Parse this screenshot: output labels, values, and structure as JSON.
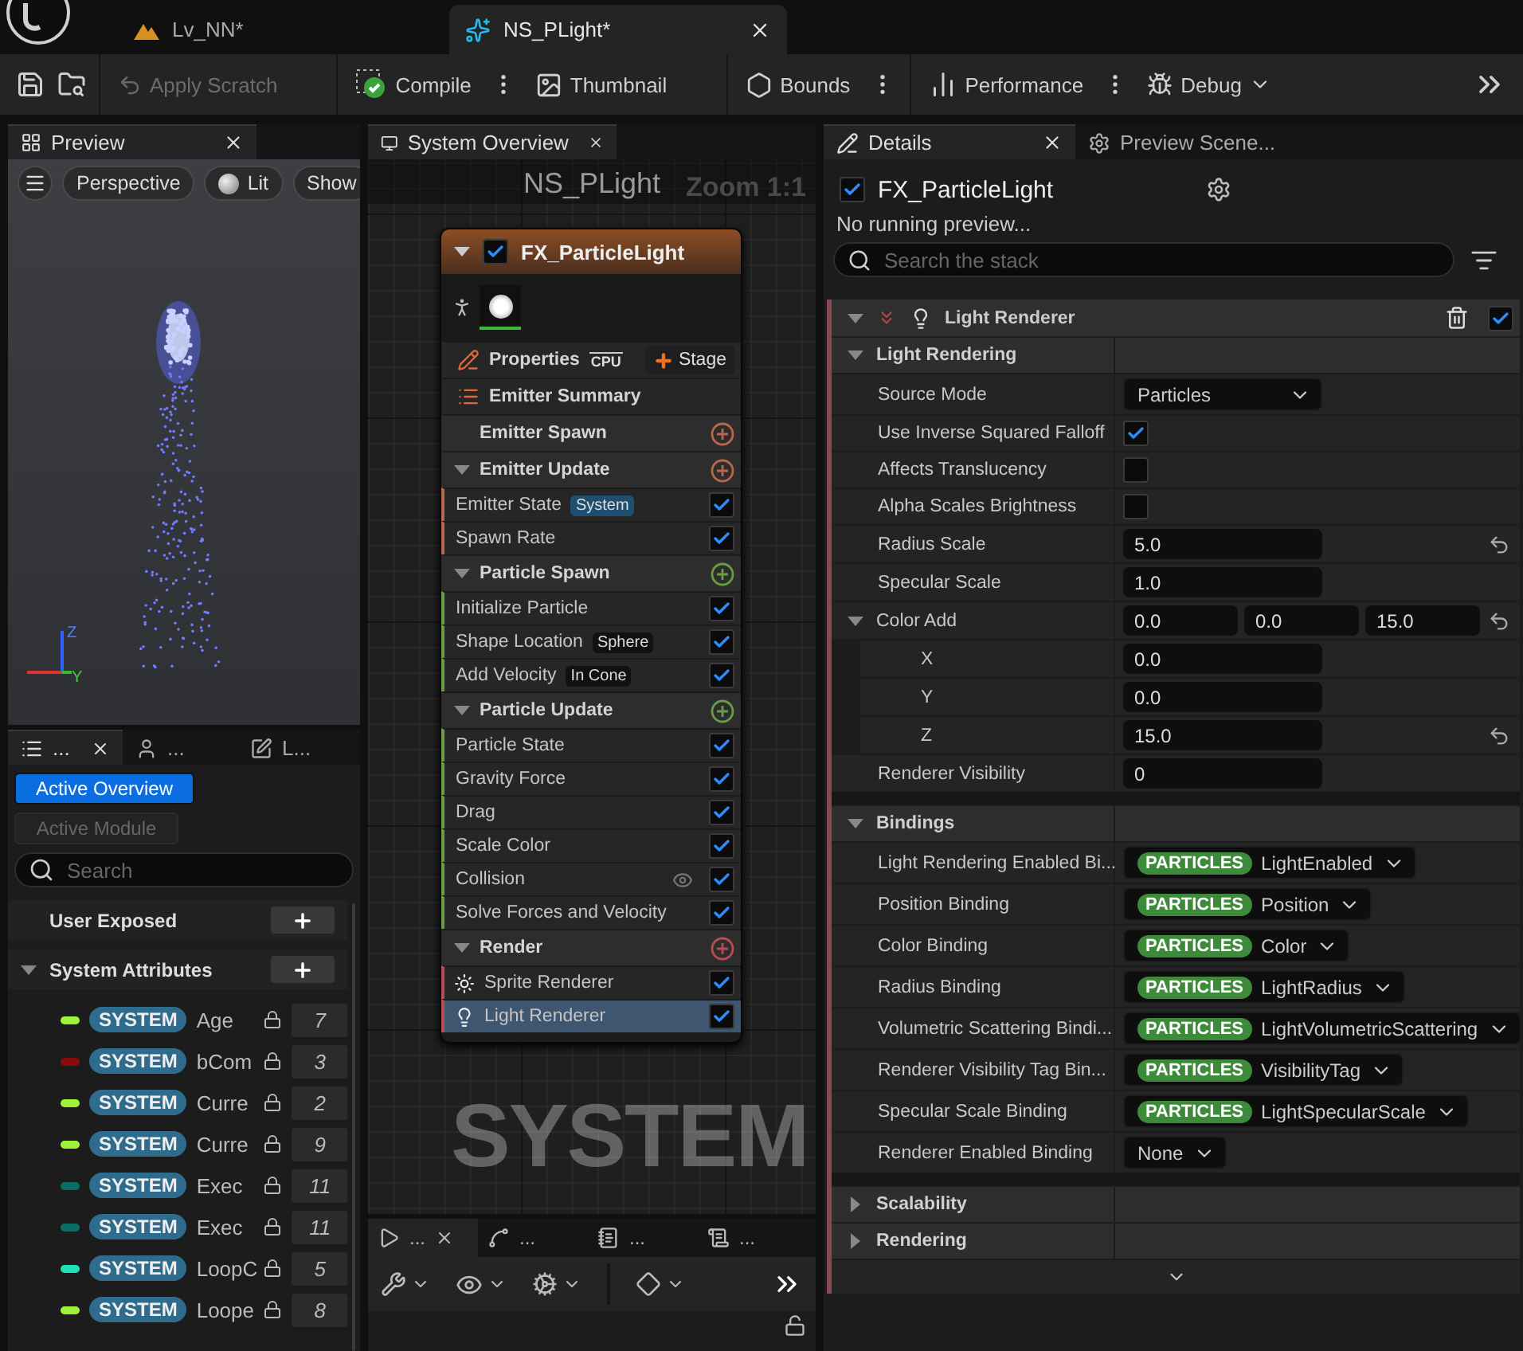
{
  "editor_tabs": [
    {
      "label": "Lv_NN*",
      "kind": "level",
      "selected": false
    },
    {
      "label": "NS_PLight*",
      "kind": "system",
      "selected": true
    }
  ],
  "toolbar": [
    {
      "label": "Apply Scratch",
      "kind": "scratch",
      "disabled": true,
      "options": false,
      "dropdown": false
    },
    {
      "label": "Compile",
      "kind": "compile",
      "disabled": false,
      "options": true,
      "dropdown": false
    },
    {
      "label": "Thumbnail",
      "kind": "thumbnail",
      "disabled": false,
      "options": false,
      "dropdown": false
    },
    {
      "label": "Bounds",
      "kind": "bounds",
      "disabled": false,
      "options": true,
      "dropdown": false
    },
    {
      "label": "Performance",
      "kind": "performance",
      "disabled": false,
      "options": true,
      "dropdown": false
    },
    {
      "label": "Debug",
      "kind": "debug",
      "disabled": false,
      "options": false,
      "dropdown": true
    }
  ],
  "preview": {
    "tab": "Preview",
    "view_buttons": [
      {
        "label": "Perspective",
        "kind": "view"
      },
      {
        "label": "Lit",
        "kind": "lighting"
      },
      {
        "label": "Show",
        "kind": "show"
      }
    ],
    "gizmo": [
      "Z",
      "Y"
    ]
  },
  "parameters": {
    "tabs": [
      {
        "label": "...",
        "selected": true
      },
      {
        "label": "...",
        "selected": false
      },
      {
        "label": "L...",
        "selected": false
      }
    ],
    "modes": [
      {
        "label": "Active Overview",
        "selected": true
      },
      {
        "label": "Active Module",
        "selected": false
      }
    ],
    "search": {
      "placeholder": "Search"
    },
    "sections": [
      {
        "title": "User Exposed"
      },
      {
        "title": "System Attributes",
        "expanded": true,
        "items": [
          {
            "namespace": "SYSTEM",
            "name": "Age",
            "color": "#9ef23a",
            "count": "7"
          },
          {
            "namespace": "SYSTEM",
            "name": "bCom",
            "color": "#8c0a0a",
            "count": "3"
          },
          {
            "namespace": "SYSTEM",
            "name": "Curre",
            "color": "#9ef23a",
            "count": "2"
          },
          {
            "namespace": "SYSTEM",
            "name": "Curre",
            "color": "#9ef23a",
            "count": "9"
          },
          {
            "namespace": "SYSTEM",
            "name": "Exec",
            "color": "#0b6e66",
            "count": "11"
          },
          {
            "namespace": "SYSTEM",
            "name": "Exec",
            "color": "#0b6e66",
            "count": "11"
          },
          {
            "namespace": "SYSTEM",
            "name": "LoopC",
            "color": "#1ee0b4",
            "count": "5"
          },
          {
            "namespace": "SYSTEM",
            "name": "Loope",
            "color": "#9ef23a",
            "count": "8"
          }
        ]
      }
    ]
  },
  "overview": {
    "tab": "System Overview",
    "graph_title": "NS_PLight",
    "zoom": "Zoom 1:1",
    "watermark": "SYSTEM",
    "node": {
      "name": "FX_ParticleLight",
      "enabled": true,
      "properties": "Properties",
      "sim_target": "CPU",
      "add_stage": "Stage",
      "summary": "Emitter Summary",
      "groups": [
        {
          "title": "Emitter Spawn",
          "color": "#b8664c"
        },
        {
          "title": "Emitter Update",
          "color": "#b8664c",
          "expanded": true,
          "modules": [
            {
              "label": "Emitter State",
              "kind": "module",
              "tag": {
                "text": "System",
                "kind": "namespace"
              },
              "enabled": true,
              "selected": false
            },
            {
              "label": "Spawn Rate",
              "kind": "module",
              "enabled": true,
              "selected": false
            }
          ]
        },
        {
          "title": "Particle Spawn",
          "color": "#6a9c46",
          "expanded": true,
          "modules": [
            {
              "label": "Initialize Particle",
              "kind": "module",
              "enabled": true,
              "selected": false
            },
            {
              "label": "Shape Location",
              "kind": "module",
              "tag": {
                "text": "Sphere",
                "kind": "mode"
              },
              "enabled": true,
              "selected": false
            },
            {
              "label": "Add Velocity",
              "kind": "module",
              "tag": {
                "text": "In Cone",
                "kind": "mode"
              },
              "enabled": true,
              "selected": false
            }
          ]
        },
        {
          "title": "Particle Update",
          "color": "#6a9c46",
          "expanded": true,
          "modules": [
            {
              "label": "Particle State",
              "kind": "module",
              "enabled": true,
              "selected": false
            },
            {
              "label": "Gravity Force",
              "kind": "module",
              "enabled": true,
              "selected": false
            },
            {
              "label": "Drag",
              "kind": "module",
              "enabled": true,
              "selected": false
            },
            {
              "label": "Scale Color",
              "kind": "module",
              "enabled": true,
              "selected": false
            },
            {
              "label": "Collision",
              "kind": "module",
              "debug": true,
              "enabled": true,
              "selected": false
            },
            {
              "label": "Solve Forces and Velocity",
              "kind": "module",
              "enabled": true,
              "selected": false
            }
          ]
        },
        {
          "title": "Render",
          "color": "#b84c54",
          "expanded": true,
          "modules": [
            {
              "label": "Sprite Renderer",
              "kind": "sprite",
              "enabled": true,
              "selected": false
            },
            {
              "label": "Light Renderer",
              "kind": "light",
              "enabled": true,
              "selected": true
            }
          ]
        }
      ]
    }
  },
  "bottom_panel": {
    "tabs": [
      {
        "label": "...",
        "selected": true
      },
      {
        "label": "...",
        "selected": false
      },
      {
        "label": "...",
        "selected": false
      },
      {
        "label": "...",
        "selected": false
      }
    ]
  },
  "details": {
    "tabs": [
      {
        "label": "Details",
        "selected": true
      },
      {
        "label": "Preview Scene...",
        "selected": false
      }
    ],
    "emitter": {
      "name": "FX_ParticleLight",
      "enabled": true
    },
    "status": "No running preview...",
    "search": {
      "placeholder": "Search the stack"
    },
    "renderer": {
      "name": "Light Renderer",
      "enabled": true
    },
    "sections": [
      {
        "title": "Light Rendering",
        "expanded": true,
        "rows": [
          {
            "label": "Source Mode",
            "kind": "dropdown",
            "value": "Particles"
          },
          {
            "label": "Use Inverse Squared Falloff",
            "kind": "checkbox",
            "checked": true
          },
          {
            "label": "Affects Translucency",
            "kind": "checkbox",
            "checked": false
          },
          {
            "label": "Alpha Scales Brightness",
            "kind": "checkbox",
            "checked": false
          },
          {
            "label": "Radius Scale",
            "kind": "number",
            "value": "5.0",
            "modified": true
          },
          {
            "label": "Specular Scale",
            "kind": "number",
            "value": "1.0",
            "modified": false
          },
          {
            "label": "Color Add",
            "kind": "vector",
            "values": [
              "0.0",
              "0.0",
              "15.0"
            ],
            "modified": true,
            "expanded": true,
            "children": [
              {
                "label": "X",
                "kind": "number",
                "value": "0.0",
                "modified": false
              },
              {
                "label": "Y",
                "kind": "number",
                "value": "0.0",
                "modified": false
              },
              {
                "label": "Z",
                "kind": "number",
                "value": "15.0",
                "modified": true
              }
            ]
          },
          {
            "label": "Renderer Visibility",
            "kind": "number",
            "value": "0",
            "modified": false
          }
        ]
      },
      {
        "title": "Bindings",
        "expanded": true,
        "rows": [
          {
            "label": "Light Rendering Enabled Bi...",
            "kind": "binding",
            "namespace": "PARTICLES",
            "value": "LightEnabled"
          },
          {
            "label": "Position Binding",
            "kind": "binding",
            "namespace": "PARTICLES",
            "value": "Position"
          },
          {
            "label": "Color Binding",
            "kind": "binding",
            "namespace": "PARTICLES",
            "value": "Color"
          },
          {
            "label": "Radius Binding",
            "kind": "binding",
            "namespace": "PARTICLES",
            "value": "LightRadius"
          },
          {
            "label": "Volumetric Scattering Bindi...",
            "kind": "binding",
            "namespace": "PARTICLES",
            "value": "LightVolumetricScattering"
          },
          {
            "label": "Renderer Visibility Tag Bin...",
            "kind": "binding",
            "namespace": "PARTICLES",
            "value": "VisibilityTag"
          },
          {
            "label": "Specular Scale Binding",
            "kind": "binding",
            "namespace": "PARTICLES",
            "value": "LightSpecularScale"
          },
          {
            "label": "Renderer Enabled Binding",
            "kind": "binding",
            "value": "None"
          }
        ]
      },
      {
        "title": "Scalability",
        "expanded": false
      },
      {
        "title": "Rendering",
        "expanded": false
      }
    ]
  }
}
